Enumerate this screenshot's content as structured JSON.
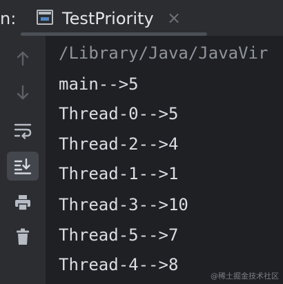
{
  "tabbar": {
    "prefix": "n:",
    "tab_title": "TestPriority",
    "close_glyph": "×"
  },
  "toolbar": {
    "buttons": [
      {
        "name": "up-arrow-icon",
        "active": false
      },
      {
        "name": "down-arrow-icon",
        "active": false
      },
      {
        "name": "soft-wrap-icon",
        "active": false
      },
      {
        "name": "scroll-to-end-icon",
        "active": true
      },
      {
        "name": "print-icon",
        "active": false
      },
      {
        "name": "trash-icon",
        "active": false
      }
    ]
  },
  "console": {
    "command": "/Library/Java/JavaVir",
    "lines": [
      "main-->5",
      "Thread-0-->5",
      "Thread-2-->4",
      "Thread-1-->1",
      "Thread-3-->10",
      "Thread-5-->7",
      "Thread-4-->8"
    ]
  },
  "watermark": "@稀土掘金技术社区",
  "colors": {
    "background": "#2b2d30",
    "console_background": "#1f2024",
    "text": "#dadde2",
    "accent_blue": "#4f86c6",
    "active_button": "#43464c"
  }
}
